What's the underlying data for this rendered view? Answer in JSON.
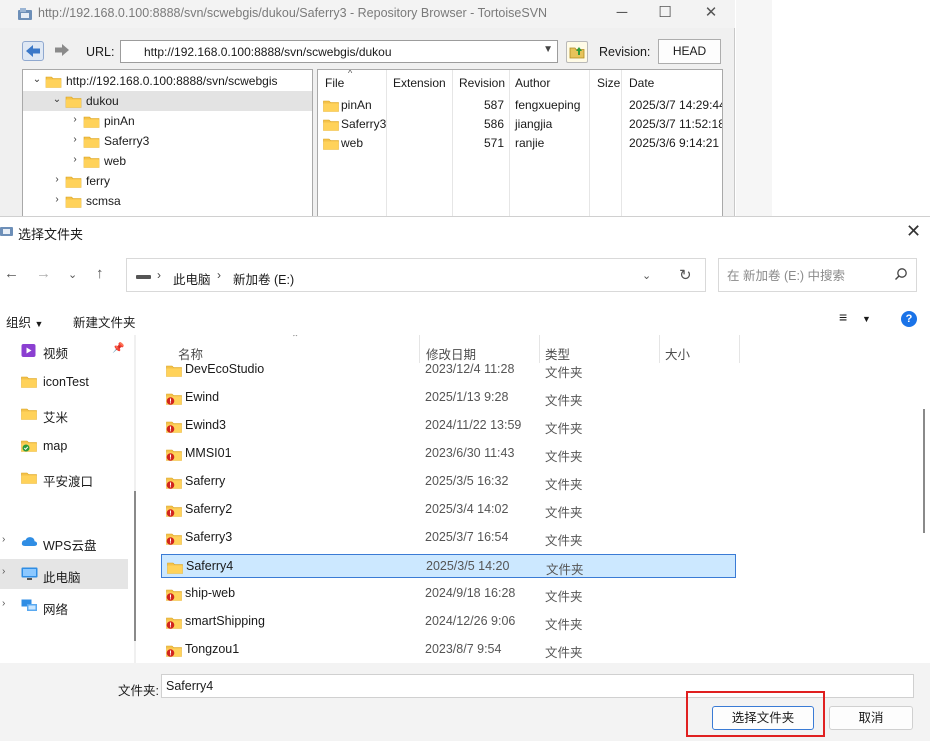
{
  "svn_window": {
    "title": "http://192.168.0.100:8888/svn/scwebgis/dukou/Saferry3 - Repository Browser - TortoiseSVN",
    "url_label": "URL:",
    "url_value": "http://192.168.0.100:8888/svn/scwebgis/dukou",
    "revision_label": "Revision:",
    "revision_button": "HEAD",
    "tree": [
      {
        "label": "http://192.168.0.100:8888/svn/scwebgis",
        "level": 0,
        "expanded": true,
        "selected": false
      },
      {
        "label": "dukou",
        "level": 1,
        "expanded": true,
        "selected": true
      },
      {
        "label": "pinAn",
        "level": 2,
        "expanded": false,
        "selected": false
      },
      {
        "label": "Saferry3",
        "level": 2,
        "expanded": false,
        "selected": false
      },
      {
        "label": "web",
        "level": 2,
        "expanded": false,
        "selected": false
      },
      {
        "label": "ferry",
        "level": 1,
        "expanded": false,
        "selected": false
      },
      {
        "label": "scmsa",
        "level": 1,
        "expanded": false,
        "selected": false
      }
    ],
    "file_columns": [
      "File",
      "Extension",
      "Revision",
      "Author",
      "Size",
      "Date"
    ],
    "files": [
      {
        "file": "pinAn",
        "extension": "",
        "revision": "587",
        "author": "fengxueping",
        "size": "",
        "date": "2025/3/7 14:29:44"
      },
      {
        "file": "Saferry3",
        "extension": "",
        "revision": "586",
        "author": "jiangjia",
        "size": "",
        "date": "2025/3/7 11:52:18"
      },
      {
        "file": "web",
        "extension": "",
        "revision": "571",
        "author": "ranjie",
        "size": "",
        "date": "2025/3/6 9:14:21"
      }
    ]
  },
  "dialog": {
    "title": "选择文件夹",
    "breadcrumb": [
      "此电脑",
      "新加卷 (E:)"
    ],
    "search_placeholder": "在 新加卷 (E:) 中搜索",
    "commands": {
      "organize": "组织",
      "new_folder": "新建文件夹"
    },
    "help": "?",
    "nav_pane": [
      {
        "label": "视频",
        "icon": "video-icon",
        "pinned": true,
        "selected": false
      },
      {
        "label": "iconTest",
        "icon": "folder-icon",
        "pinned": false,
        "selected": false
      },
      {
        "label": "艾米",
        "icon": "folder-icon",
        "pinned": false,
        "selected": false
      },
      {
        "label": "map",
        "icon": "folder-sync-icon",
        "pinned": false,
        "selected": false
      },
      {
        "label": "平安渡口",
        "icon": "folder-icon",
        "pinned": false,
        "selected": false
      },
      {
        "label": "WPS云盘",
        "icon": "cloud-icon",
        "pinned": false,
        "selected": false
      },
      {
        "label": "此电脑",
        "icon": "computer-icon",
        "pinned": false,
        "selected": true
      },
      {
        "label": "网络",
        "icon": "network-icon",
        "pinned": false,
        "selected": false
      }
    ],
    "columns": {
      "name": "名称",
      "modified": "修改日期",
      "type": "类型",
      "size": "大小"
    },
    "rows": [
      {
        "name": "DevEcoStudio",
        "modified": "2023/12/4 11:28",
        "type": "文件夹",
        "svn_conflict": false,
        "selected": false
      },
      {
        "name": "Ewind",
        "modified": "2025/1/13 9:28",
        "type": "文件夹",
        "svn_conflict": true,
        "selected": false
      },
      {
        "name": "Ewind3",
        "modified": "2024/11/22 13:59",
        "type": "文件夹",
        "svn_conflict": true,
        "selected": false
      },
      {
        "name": "MMSI01",
        "modified": "2023/6/30 11:43",
        "type": "文件夹",
        "svn_conflict": true,
        "selected": false
      },
      {
        "name": "Saferry",
        "modified": "2025/3/5 16:32",
        "type": "文件夹",
        "svn_conflict": true,
        "selected": false
      },
      {
        "name": "Saferry2",
        "modified": "2025/3/4 14:02",
        "type": "文件夹",
        "svn_conflict": true,
        "selected": false
      },
      {
        "name": "Saferry3",
        "modified": "2025/3/7 16:54",
        "type": "文件夹",
        "svn_conflict": true,
        "selected": false
      },
      {
        "name": "Saferry4",
        "modified": "2025/3/5 14:20",
        "type": "文件夹",
        "svn_conflict": false,
        "selected": true
      },
      {
        "name": "ship-web",
        "modified": "2024/9/18 16:28",
        "type": "文件夹",
        "svn_conflict": true,
        "selected": false
      },
      {
        "name": "smartShipping",
        "modified": "2024/12/26 9:06",
        "type": "文件夹",
        "svn_conflict": true,
        "selected": false
      },
      {
        "name": "Tongzou1",
        "modified": "2023/8/7 9:54",
        "type": "文件夹",
        "svn_conflict": true,
        "selected": false
      }
    ],
    "folder_label": "文件夹:",
    "folder_value": "Saferry4",
    "select_button": "选择文件夹",
    "cancel_button": "取消"
  }
}
